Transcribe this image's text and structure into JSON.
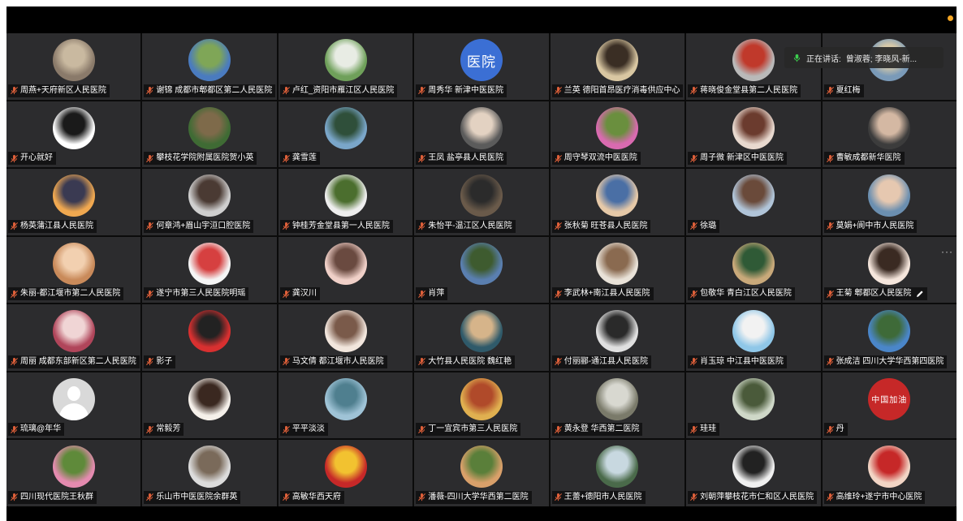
{
  "speaking_indicator": {
    "label": "正在讲话:",
    "names": "曾淑蓉; 李晓风-新..."
  },
  "participants": [
    {
      "name": "周燕+天府新区人民医院",
      "avatar": [
        "#8a7a6a",
        "#c9b9a0"
      ]
    },
    {
      "name": "谢锦 成都市郫都区第二人民医院",
      "avatar": [
        "#4a7bbf",
        "#7fa657"
      ]
    },
    {
      "name": "卢红_资阳市雁江区人民医院",
      "avatar": [
        "#6fa05a",
        "#e8ece4"
      ]
    },
    {
      "name": "周秀华 新津中医医院",
      "avatar_text": "医院"
    },
    {
      "name": "兰英 德阳首昂医疗消毒供应中心",
      "avatar": [
        "#d9c7a2",
        "#3a2e24"
      ]
    },
    {
      "name": "蒋晓俊金堂县第二人民医院",
      "avatar": [
        "#b9b9b9",
        "#c0392b"
      ]
    },
    {
      "name": "夏红梅",
      "avatar": [
        "#7a9ab8",
        "#d7c9a8"
      ]
    },
    {
      "name": "开心就好",
      "avatar": [
        "#ffffff",
        "#1a1a1a"
      ]
    },
    {
      "name": "攀枝花学院附属医院贺小英",
      "avatar": [
        "#3f6b34",
        "#7e6a4a"
      ]
    },
    {
      "name": "龚雪莲",
      "avatar": [
        "#7aa6c9",
        "#2f4f3a"
      ]
    },
    {
      "name": "王凤 盐亭县人民医院",
      "avatar": [
        "#5b5b5b",
        "#e3d2c2"
      ]
    },
    {
      "name": "周守琴双流中医医院",
      "avatar": [
        "#d96ab0",
        "#6a8f3e"
      ]
    },
    {
      "name": "周子微 新津区中医医院",
      "avatar": [
        "#e8d9cf",
        "#6b3b2e"
      ]
    },
    {
      "name": "曹敏成都新华医院",
      "avatar": [
        "#3c3c3c",
        "#d4b8a3"
      ]
    },
    {
      "name": "杨英蒲江县人民医院",
      "avatar": [
        "#f0a850",
        "#3a3a52"
      ]
    },
    {
      "name": "何章鸿+眉山宇洹口腔医院",
      "avatar": [
        "#cfcfcf",
        "#4a3a33"
      ]
    },
    {
      "name": "钟桂芳金堂县第一人民医院",
      "avatar": [
        "#eeeeee",
        "#4b6e2e"
      ]
    },
    {
      "name": "朱怡平-温江区人民医院",
      "avatar": [
        "#6a5a4a",
        "#2b2b2b"
      ]
    },
    {
      "name": "张秋菊 旺苍县人民医院",
      "avatar": [
        "#e6c9a8",
        "#4a6fa5"
      ]
    },
    {
      "name": "徐璐",
      "avatar": [
        "#b0c4d8",
        "#6a4a3a"
      ]
    },
    {
      "name": "莫娟+阆中市人民医院",
      "avatar": [
        "#6b8fb0",
        "#e6c8b0"
      ]
    },
    {
      "name": "朱丽-都江堰市第二人民医院",
      "avatar": [
        "#c98a5a",
        "#f2d0b0"
      ]
    },
    {
      "name": "遂宁市第三人民医院明瑶",
      "avatar": [
        "#f5f5f5",
        "#d64040"
      ]
    },
    {
      "name": "龚汉川",
      "avatar": [
        "#f0d0c8",
        "#6a4a40"
      ]
    },
    {
      "name": "肖萍",
      "avatar": [
        "#5a7fb0",
        "#3e5b2f"
      ]
    },
    {
      "name": "李武林+南江县人民医院",
      "avatar": [
        "#e9e2d8",
        "#8a6a50"
      ]
    },
    {
      "name": "包敬华 青白江区人民医院",
      "avatar": [
        "#c9a97a",
        "#2f5a36"
      ]
    },
    {
      "name": "王菊 郫都区人民医院",
      "avatar": [
        "#f5e6dc",
        "#3a2a22"
      ],
      "pencil": true
    },
    {
      "name": "周丽 成都东部新区第二人民医院",
      "avatar": [
        "#b0455a",
        "#f0d5d5"
      ]
    },
    {
      "name": "影子",
      "avatar": [
        "#d83030",
        "#222222"
      ]
    },
    {
      "name": "马文倩 都江堰市人民医院",
      "avatar": [
        "#f2e6dd",
        "#7a5a4a"
      ]
    },
    {
      "name": "大竹县人民医院 魏红艳",
      "avatar": [
        "#2f5a6a",
        "#d6b48a"
      ]
    },
    {
      "name": "付丽郦-通江县人民医院",
      "avatar": [
        "#e0e0e0",
        "#2a2a2a"
      ]
    },
    {
      "name": "肖玉琼 中江县中医医院",
      "avatar": [
        "#8fc7e8",
        "#f2f2f2"
      ]
    },
    {
      "name": "张成洁 四川大学华西第四医院",
      "avatar": [
        "#4a86c9",
        "#3e6a38"
      ]
    },
    {
      "name": "琉璃@年华",
      "avatar_default": true
    },
    {
      "name": "常毅芳",
      "avatar": [
        "#f5f0ea",
        "#3a2820"
      ]
    },
    {
      "name": "平平淡淡",
      "avatar": [
        "#9fc3d6",
        "#4f7f8f"
      ]
    },
    {
      "name": "丁一宜宾市第三人民医院",
      "avatar": [
        "#e0b050",
        "#b04a2a"
      ]
    },
    {
      "name": "黄永登 华西第二医院",
      "avatar": [
        "#7a7a6a",
        "#d8d8d0"
      ]
    },
    {
      "name": "珪珪",
      "avatar": [
        "#cfd8c8",
        "#4a5a3a"
      ]
    },
    {
      "name": "丹",
      "avatar_text": "中国加油",
      "avatar_text_bg": "#c62828"
    },
    {
      "name": "四川现代医院王秋群",
      "avatar": [
        "#e58bb0",
        "#5f8a3a"
      ]
    },
    {
      "name": "乐山市中医医院余群英",
      "avatar": [
        "#dcdcdc",
        "#7a6a5a"
      ]
    },
    {
      "name": "高敏华西天府",
      "avatar": [
        "#c62828",
        "#f2c230"
      ]
    },
    {
      "name": "潘薇-四川大学华西第二医院",
      "avatar": [
        "#d9a06a",
        "#5a7f3a"
      ]
    },
    {
      "name": "王蕾+德阳市人民医院",
      "avatar": [
        "#4a6a4a",
        "#c8d8e0"
      ]
    },
    {
      "name": "刘朝萍攀枝花市仁和区人民医院",
      "avatar": [
        "#f0f0f0",
        "#222222"
      ]
    },
    {
      "name": "高维玲+遂宁市中心医院",
      "avatar": [
        "#f2d5c5",
        "#c62828"
      ]
    }
  ]
}
